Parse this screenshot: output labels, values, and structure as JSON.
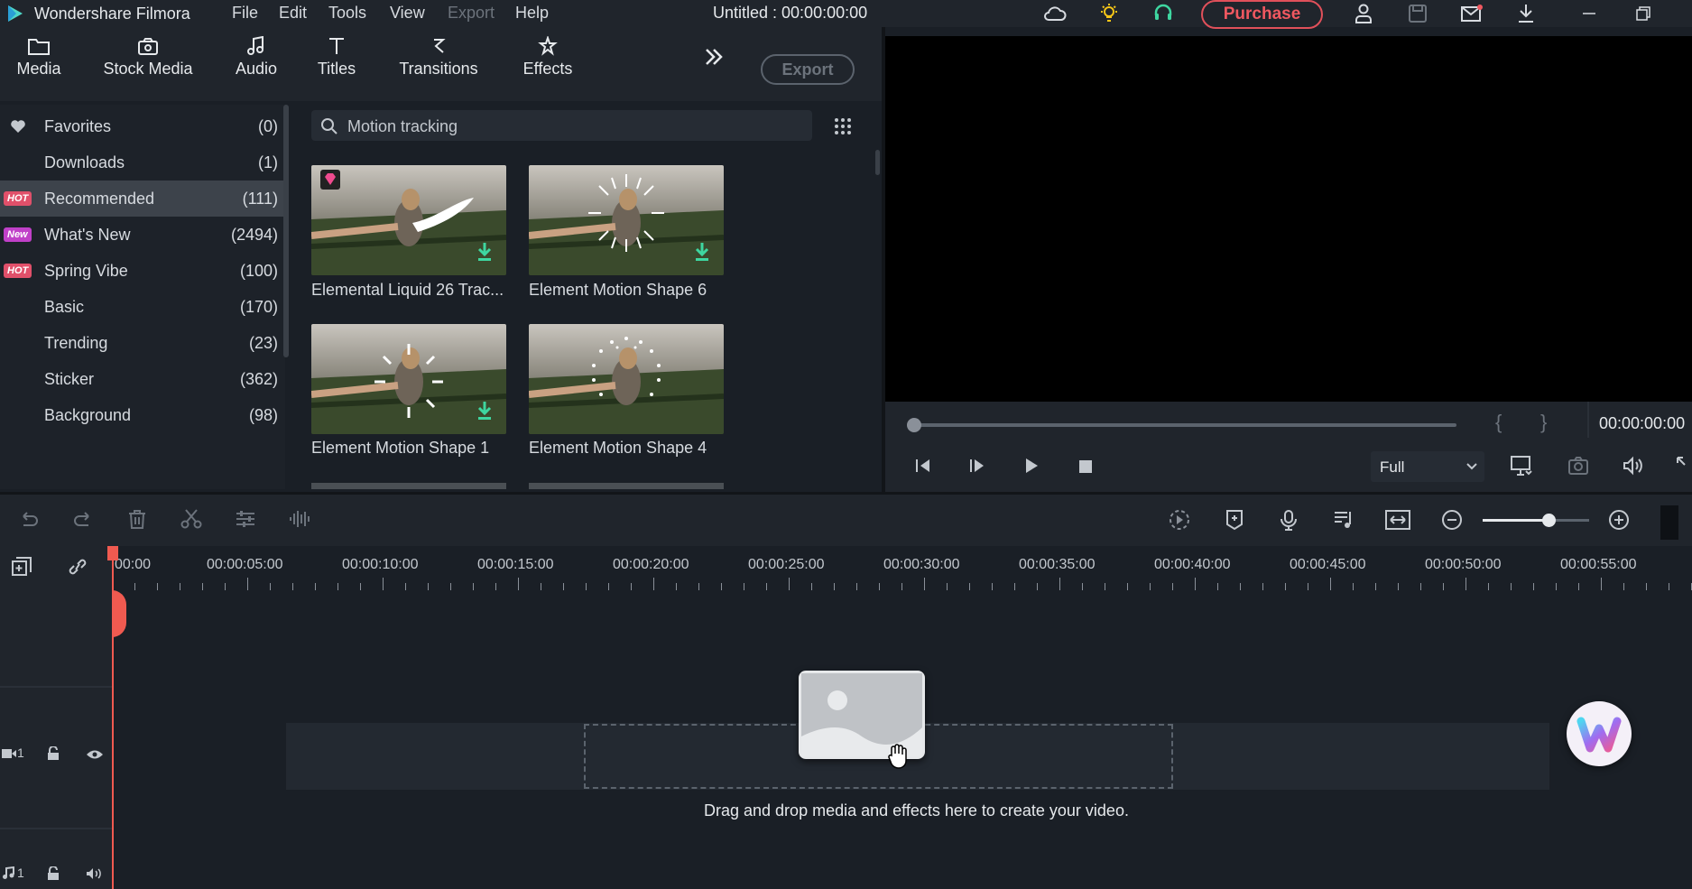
{
  "app": {
    "name": "Wondershare Filmora",
    "project_title": "Untitled : 00:00:00:00"
  },
  "menu": [
    "File",
    "Edit",
    "Tools",
    "View",
    "Export",
    "Help"
  ],
  "purchase_label": "Purchase",
  "tabs": [
    {
      "label": "Media",
      "icon": "folder-icon"
    },
    {
      "label": "Stock Media",
      "icon": "stock-media-icon"
    },
    {
      "label": "Audio",
      "icon": "music-note-icon"
    },
    {
      "label": "Titles",
      "icon": "text-icon"
    },
    {
      "label": "Transitions",
      "icon": "transitions-icon"
    },
    {
      "label": "Effects",
      "icon": "effects-icon"
    }
  ],
  "export_label": "Export",
  "categories": [
    {
      "label": "Favorites",
      "count": "(0)",
      "badge": ""
    },
    {
      "label": "Downloads",
      "count": "(1)",
      "badge": ""
    },
    {
      "label": "Recommended",
      "count": "(111)",
      "badge": "HOT"
    },
    {
      "label": "What's New",
      "count": "(2494)",
      "badge": "New"
    },
    {
      "label": "Spring Vibe",
      "count": "(100)",
      "badge": "HOT"
    },
    {
      "label": "Basic",
      "count": "(170)",
      "badge": ""
    },
    {
      "label": "Trending",
      "count": "(23)",
      "badge": ""
    },
    {
      "label": "Sticker",
      "count": "(362)",
      "badge": ""
    },
    {
      "label": "Background",
      "count": "(98)",
      "badge": ""
    }
  ],
  "search": {
    "value": "Motion tracking"
  },
  "effects": [
    {
      "label": "Elemental Liquid 26 Trac...",
      "premium": true,
      "download": true
    },
    {
      "label": "Element Motion Shape 6",
      "premium": false,
      "download": true
    },
    {
      "label": "Element Motion Shape 1",
      "premium": false,
      "download": true
    },
    {
      "label": "Element Motion Shape 4",
      "premium": false,
      "download": false
    }
  ],
  "preview": {
    "timecode": "00:00:00:00",
    "quality": "Full",
    "mark_in": "{",
    "mark_out": "}"
  },
  "timeline": {
    "ruler": [
      "00:00",
      "00:00:05:00",
      "00:00:10:00",
      "00:00:15:00",
      "00:00:20:00",
      "00:00:25:00",
      "00:00:30:00",
      "00:00:35:00",
      "00:00:40:00",
      "00:00:45:00",
      "00:00:50:00",
      "00:00:55:00"
    ],
    "video_track": "1",
    "audio_track": "1",
    "drop_hint": "Drag and drop media and effects here to create your video.",
    "zoom_level": 0.62
  },
  "colors": {
    "accent_red": "#f05860",
    "download_green": "#3ed6a0",
    "playhead": "#f05a50"
  }
}
